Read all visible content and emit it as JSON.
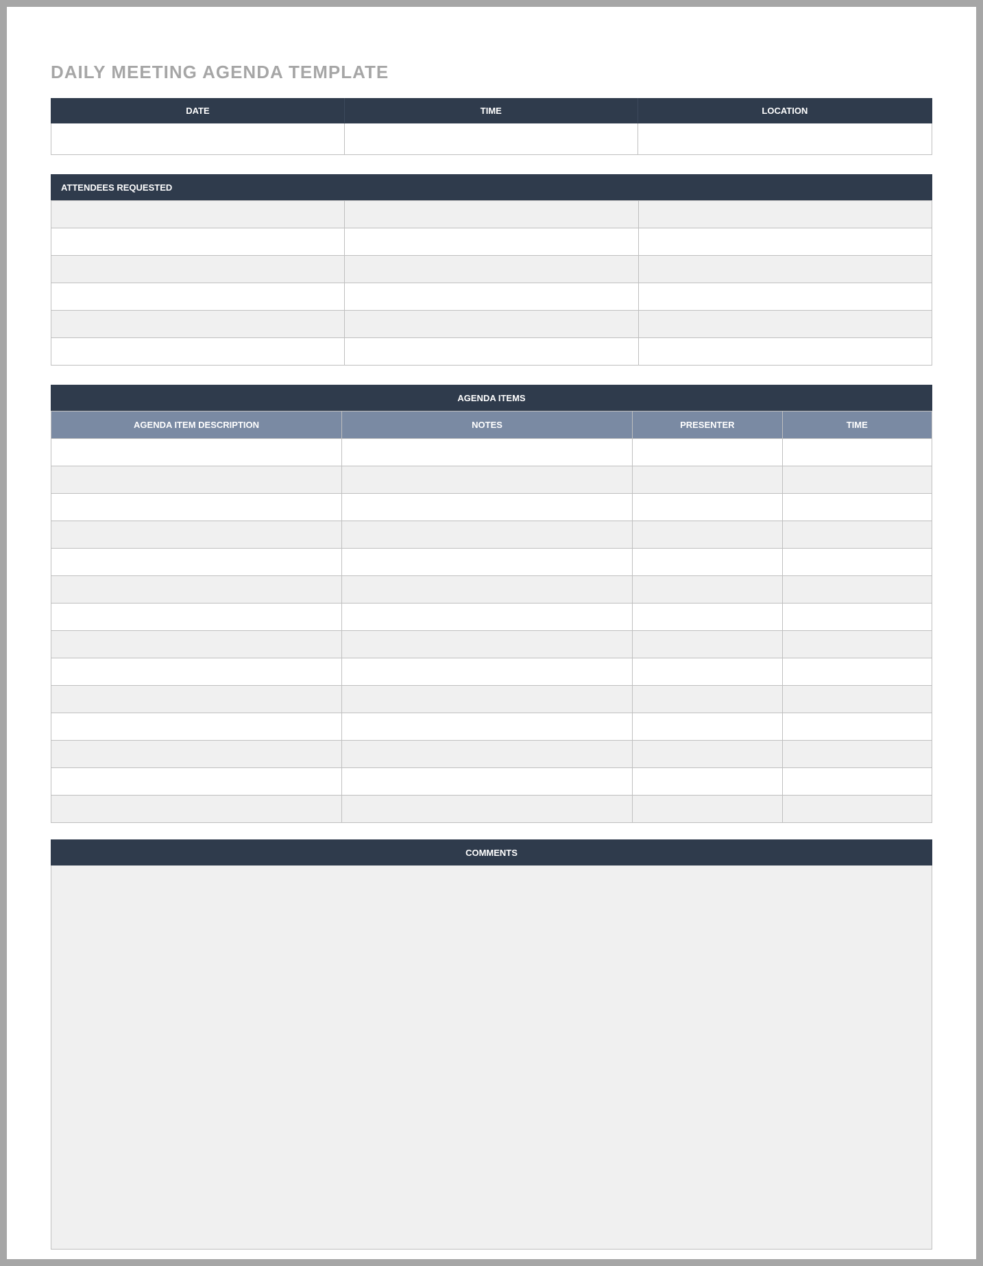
{
  "title": "DAILY MEETING AGENDA TEMPLATE",
  "section1": {
    "headers": {
      "date": "DATE",
      "time": "TIME",
      "location": "LOCATION"
    },
    "values": {
      "date": "",
      "time": "",
      "location": ""
    }
  },
  "section2": {
    "header": "ATTENDEES REQUESTED",
    "rows": [
      [
        "",
        "",
        ""
      ],
      [
        "",
        "",
        ""
      ],
      [
        "",
        "",
        ""
      ],
      [
        "",
        "",
        ""
      ],
      [
        "",
        "",
        ""
      ],
      [
        "",
        "",
        ""
      ]
    ]
  },
  "section3": {
    "header": "AGENDA ITEMS",
    "columns": {
      "desc": "AGENDA ITEM DESCRIPTION",
      "notes": "NOTES",
      "presenter": "PRESENTER",
      "time": "TIME"
    },
    "rows": [
      [
        "",
        "",
        "",
        ""
      ],
      [
        "",
        "",
        "",
        ""
      ],
      [
        "",
        "",
        "",
        ""
      ],
      [
        "",
        "",
        "",
        ""
      ],
      [
        "",
        "",
        "",
        ""
      ],
      [
        "",
        "",
        "",
        ""
      ],
      [
        "",
        "",
        "",
        ""
      ],
      [
        "",
        "",
        "",
        ""
      ],
      [
        "",
        "",
        "",
        ""
      ],
      [
        "",
        "",
        "",
        ""
      ],
      [
        "",
        "",
        "",
        ""
      ],
      [
        "",
        "",
        "",
        ""
      ],
      [
        "",
        "",
        "",
        ""
      ],
      [
        "",
        "",
        "",
        ""
      ]
    ]
  },
  "section4": {
    "header": "COMMENTS",
    "body": ""
  }
}
